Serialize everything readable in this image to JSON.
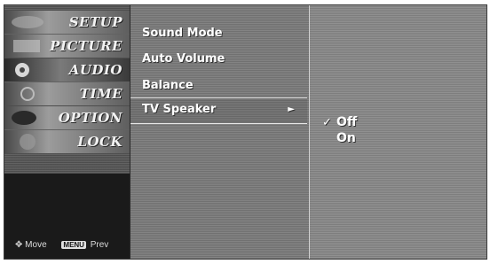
{
  "tabs": [
    {
      "label": "SETUP",
      "icon": "setup-icon"
    },
    {
      "label": "PICTURE",
      "icon": "picture-icon"
    },
    {
      "label": "AUDIO",
      "icon": "audio-icon",
      "active": true
    },
    {
      "label": "TIME",
      "icon": "time-icon"
    },
    {
      "label": "OPTION",
      "icon": "option-icon"
    },
    {
      "label": "LOCK",
      "icon": "lock-icon"
    }
  ],
  "nav_hint": {
    "move_label": "Move",
    "menu_key": "MENU",
    "prev_label": "Prev"
  },
  "menu": {
    "items": [
      "Sound Mode",
      "Auto Volume",
      "Balance",
      "TV Speaker"
    ],
    "selected_index": 3,
    "arrow": "►"
  },
  "submenu": {
    "options": [
      "Off",
      "On"
    ],
    "checked_index": 0,
    "check_mark": "✓"
  },
  "colors": {
    "text": "#ffffff",
    "panel": "#7e7e7e",
    "dark": "#1a1a1a"
  }
}
